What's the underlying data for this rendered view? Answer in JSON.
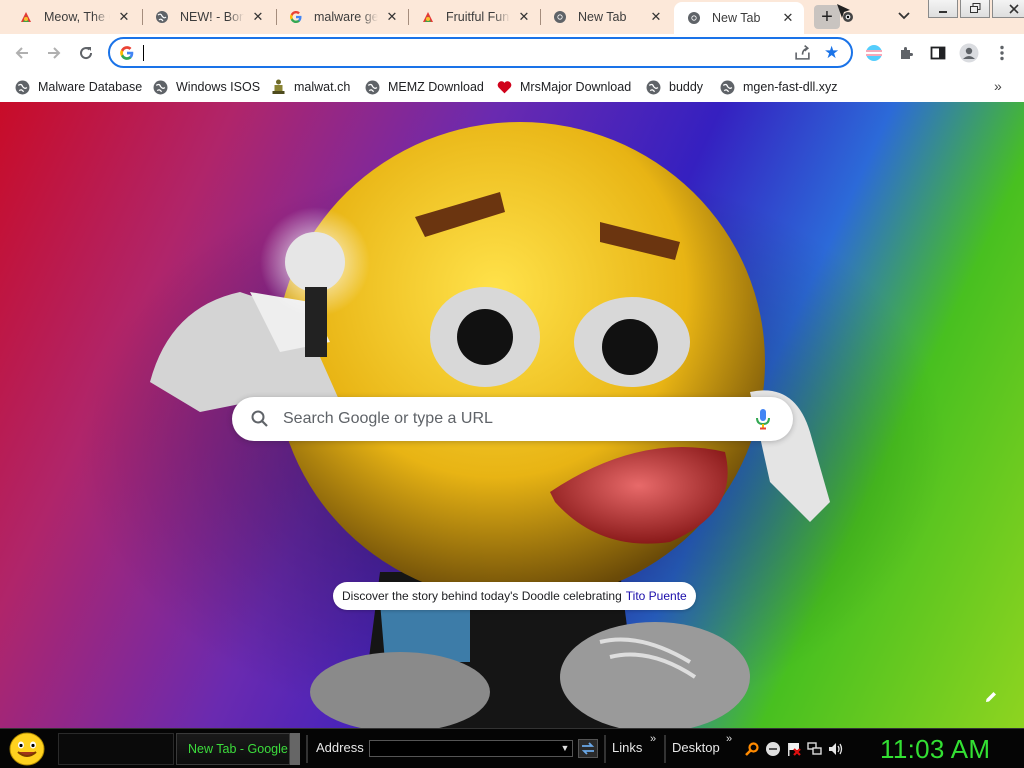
{
  "tabs": [
    {
      "title": "Meow, The Cat",
      "favicon": "fruit-favicon"
    },
    {
      "title": "NEW! - BonziBuddy",
      "favicon": "globe-favicon"
    },
    {
      "title": "malware generator",
      "favicon": "google-favicon"
    },
    {
      "title": "Fruitful Fun - Home",
      "favicon": "fruit-favicon"
    },
    {
      "title": "New Tab",
      "favicon": "chrome-favicon"
    },
    {
      "title": "New Tab",
      "favicon": "chrome-favicon",
      "active": true
    }
  ],
  "window_controls": {
    "minimize": "0",
    "restore": "1",
    "close": "r"
  },
  "omnibox": {
    "value": "",
    "placeholder": ""
  },
  "bookmarks": [
    {
      "label": "Malware Database",
      "icon": "globe-icon"
    },
    {
      "label": "Windows ISOS",
      "icon": "globe-icon"
    },
    {
      "label": "malwat.ch",
      "icon": "figure-icon"
    },
    {
      "label": "MEMZ Download",
      "icon": "globe-icon"
    },
    {
      "label": "MrsMajor Download",
      "icon": "heart-icon"
    },
    {
      "label": "buddy",
      "icon": "globe-icon"
    },
    {
      "label": "mgen-fast-dll.xyz",
      "icon": "globe-icon"
    }
  ],
  "bookmarks_more": "»",
  "search": {
    "placeholder": "Search Google or type a URL"
  },
  "doodle": {
    "text": "Discover the story behind today's Doodle celebrating",
    "link": "Tito Puente"
  },
  "taskbar": {
    "task_label": "New Tab - Google Chrome",
    "address_label": "Address",
    "links_label": "Links",
    "desktop_label": "Desktop",
    "chevron": "»",
    "clock": "11:03 AM"
  },
  "colors": {
    "accent": "#1a73e8",
    "tab_strip": "#fce8d9",
    "clock_green": "#33e033"
  }
}
